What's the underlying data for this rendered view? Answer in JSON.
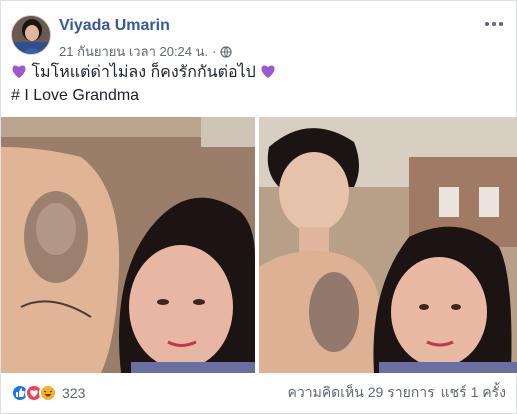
{
  "post": {
    "author": "Viyada Umarin",
    "date": "21 กันยายน เวลา 20:24 น.",
    "date_separator": "·",
    "privacy_icon": "globe-icon",
    "more_icon": "ellipsis-icon",
    "text_line1": "โมโหแต่ด่าไม่ลง ก็คงรักกันต่อไป",
    "text_line2": "# I Love Grandma",
    "emoji_left": "purple-heart",
    "emoji_right": "purple-heart"
  },
  "footer": {
    "reaction_icons": [
      "like-icon",
      "love-icon",
      "haha-icon"
    ],
    "reaction_count": "323",
    "comments": "ความคิดเห็น 29 รายการ",
    "shares": "แชร์ 1 ครั้ง"
  },
  "colors": {
    "author": "#385898",
    "meta": "#616770",
    "heart": "#9b59d0",
    "like": "#1877f2",
    "love": "#f33e58",
    "haha": "#f7b125"
  }
}
